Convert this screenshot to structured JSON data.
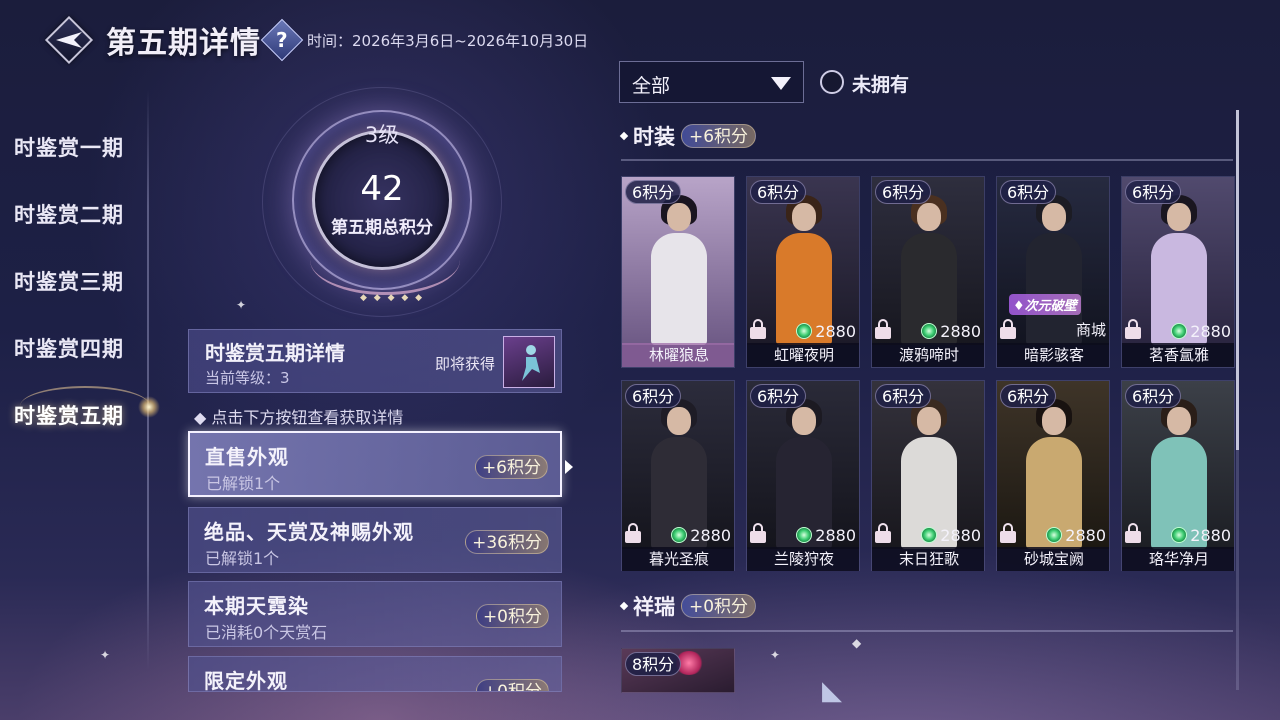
{
  "header": {
    "title": "第五期详情",
    "help_symbol": "?",
    "time": "时间：2026年3月6日~2026年10月30日"
  },
  "periods": [
    "时鉴赏一期",
    "时鉴赏二期",
    "时鉴赏三期",
    "时鉴赏四期",
    "时鉴赏五期"
  ],
  "active_period_index": 4,
  "level": {
    "level_label": "3级",
    "score": "42",
    "score_label": "第五期总积分"
  },
  "detail": {
    "title": "时鉴赏五期详情",
    "current_level": "当前等级：3",
    "coming_soon": "即将获得"
  },
  "hint": "点击下方按钮查看获取详情",
  "categories": [
    {
      "title": "直售外观",
      "sub": "已解锁1个",
      "points": "+6积分"
    },
    {
      "title": "绝品、天赏及神赐外观",
      "sub": "已解锁1个",
      "points": "+36积分"
    },
    {
      "title": "本期天霓染",
      "sub": "已消耗0个天赏石",
      "points": "+0积分"
    },
    {
      "title": "限定外观",
      "sub": "",
      "points": "+0积分"
    }
  ],
  "filter": {
    "dropdown_value": "全部",
    "unowned_label": "未拥有"
  },
  "sections": [
    {
      "name": "时装",
      "points": "+6积分"
    },
    {
      "name": "祥瑞",
      "points": "+0积分"
    }
  ],
  "fashion_items": [
    {
      "name": "林曜狼息",
      "points": "6积分",
      "price": "",
      "owned": true,
      "shop": "",
      "badge": "",
      "colors": {
        "bg1": "#b8a4c8",
        "bg2": "#6e5a86",
        "hair": "#1a1520",
        "outfit": "#e7e4ea"
      }
    },
    {
      "name": "虹曜夜明",
      "points": "6积分",
      "price": "2880",
      "owned": false,
      "shop": "",
      "badge": "",
      "colors": {
        "bg1": "#3a3550",
        "bg2": "#1c1a28",
        "hair": "#3a2418",
        "outfit": "#d97a2a"
      }
    },
    {
      "name": "渡鸦啼时",
      "points": "6积分",
      "price": "2880",
      "owned": false,
      "shop": "",
      "badge": "",
      "colors": {
        "bg1": "#2e2e3e",
        "bg2": "#17171f",
        "hair": "#4a3020",
        "outfit": "#2a2a2e"
      }
    },
    {
      "name": "暗影骇客",
      "points": "6积分",
      "price": "",
      "owned": false,
      "shop": "商城",
      "badge": "次元破壁",
      "colors": {
        "bg1": "#262a40",
        "bg2": "#121420",
        "hair": "#1c1c24",
        "outfit": "#222430"
      }
    },
    {
      "name": "茗香氲雅",
      "points": "6积分",
      "price": "2880",
      "owned": false,
      "shop": "",
      "badge": "",
      "colors": {
        "bg1": "#514a6e",
        "bg2": "#2a2540",
        "hair": "#1a1620",
        "outfit": "#c9b8e0"
      }
    },
    {
      "name": "暮光圣痕",
      "points": "6积分",
      "price": "2880",
      "owned": false,
      "shop": "",
      "badge": "",
      "colors": {
        "bg1": "#2c2c3c",
        "bg2": "#15151d",
        "hair": "#1e1c26",
        "outfit": "#2e2c36"
      }
    },
    {
      "name": "兰陵狩夜",
      "points": "6积分",
      "price": "2880",
      "owned": false,
      "shop": "",
      "badge": "",
      "colors": {
        "bg1": "#2a2a38",
        "bg2": "#14141c",
        "hair": "#1c1a22",
        "outfit": "#262432"
      }
    },
    {
      "name": "末日狂歌",
      "points": "6积分",
      "price": "2880",
      "owned": false,
      "shop": "",
      "badge": "",
      "colors": {
        "bg1": "#34323c",
        "bg2": "#18171d",
        "hair": "#3a2a20",
        "outfit": "#dcdad8"
      }
    },
    {
      "name": "砂城宝阙",
      "points": "6积分",
      "price": "2880",
      "owned": false,
      "shop": "",
      "badge": "",
      "colors": {
        "bg1": "#3e3428",
        "bg2": "#1c1812",
        "hair": "#181210",
        "outfit": "#c9a970"
      }
    },
    {
      "name": "珞华净月",
      "points": "6积分",
      "price": "2880",
      "owned": false,
      "shop": "",
      "badge": "",
      "colors": {
        "bg1": "#3c4048",
        "bg2": "#1c1e24",
        "hair": "#2a1e18",
        "outfit": "#7fc2b8"
      }
    }
  ],
  "xiangrui_items": [
    {
      "points": "8积分"
    }
  ]
}
